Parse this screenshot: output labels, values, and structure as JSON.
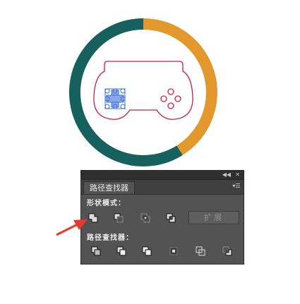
{
  "panel": {
    "title_tab": "路径查找器",
    "window_controls": {
      "collapse_icon": "double-chevron-left",
      "close_icon": "close-x"
    },
    "menu_icon": "panel-menu-icon",
    "shape_modes": {
      "label": "形状模式：",
      "buttons": [
        "unite",
        "minus-front",
        "intersect",
        "exclude"
      ],
      "expand_label": "扩展"
    },
    "pathfinders": {
      "label": "路径查找器：",
      "buttons": [
        "divide",
        "trim",
        "merge",
        "crop",
        "outline",
        "minus-back"
      ]
    }
  },
  "artwork": {
    "ring_colors": {
      "teal": "#16605e",
      "orange": "#e2982c"
    },
    "controller_stroke": "#cc1f3a",
    "selection_color": "#3b6fd6"
  },
  "annotation": {
    "arrow_color": "#e8392b"
  }
}
